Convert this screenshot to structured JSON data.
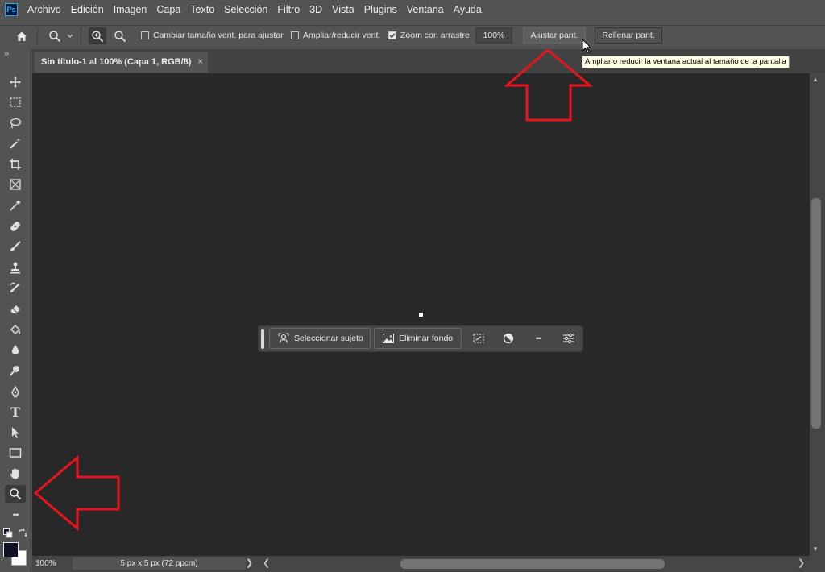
{
  "app": {
    "logo_text": "Ps"
  },
  "menu": [
    "Archivo",
    "Edición",
    "Imagen",
    "Capa",
    "Texto",
    "Selección",
    "Filtro",
    "3D",
    "Vista",
    "Plugins",
    "Ventana",
    "Ayuda"
  ],
  "options_bar": {
    "resize_windows_label": "Cambiar tamaño vent. para ajustar",
    "resize_windows_checked": false,
    "zoom_all_windows_label": "Ampliar/reducir vent.",
    "zoom_all_windows_checked": false,
    "scrubby_zoom_label": "Zoom con arrastre",
    "scrubby_zoom_checked": true,
    "zoom_value": "100%",
    "fit_screen_label": "Ajustar pant.",
    "fill_screen_label": "Rellenar pant."
  },
  "tooltip": "Ampliar o reducir la ventana actual al tamaño de la pantalla",
  "document": {
    "tab_title": "Sin título-1 al 100% (Capa 1, RGB/8)",
    "close_glyph": "×"
  },
  "toolbar": {
    "collapse_glyph": "»",
    "tools": [
      "move-tool",
      "marquee-tool",
      "lasso-tool",
      "magic-wand-tool",
      "crop-tool",
      "frame-tool",
      "eyedropper-tool",
      "spot-healing-tool",
      "brush-tool",
      "clone-stamp-tool",
      "history-brush-tool",
      "eraser-tool",
      "paint-bucket-tool",
      "blur-tool",
      "dodge-tool",
      "pen-tool",
      "type-tool",
      "path-selection-tool",
      "rectangle-tool",
      "hand-tool",
      "zoom-tool",
      "edit-toolbar"
    ],
    "active_tool": "zoom-tool",
    "type_tool_glyph": "T",
    "more_glyph": "•••"
  },
  "contextual_taskbar": {
    "select_subject_label": "Seleccionar sujeto",
    "remove_background_label": "Eliminar fondo",
    "more_glyph": "•••"
  },
  "status_bar": {
    "zoom": "100%",
    "info": "5 px x 5 px (72 ppcm)",
    "arrow_glyph": "❯"
  },
  "colors": {
    "foreground": "#0d1426",
    "background": "#ffffff",
    "annotation_arrow": "#e8141e"
  }
}
